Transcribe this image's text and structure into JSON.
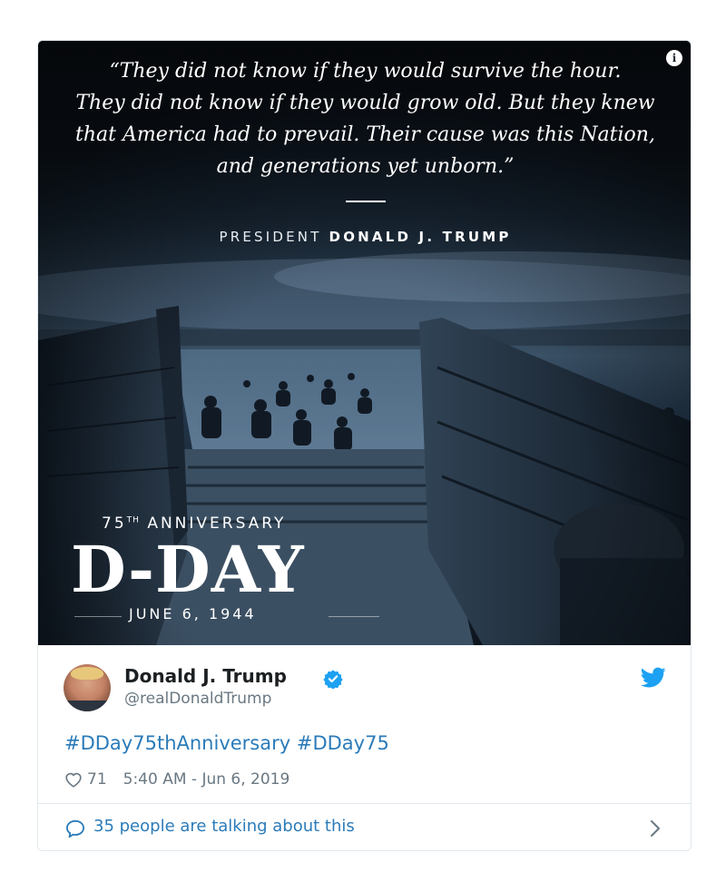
{
  "graphic": {
    "quote_lines": [
      "“They did not know if they would survive the hour.",
      "They did not know if they would grow old. But they knew",
      "that America had to prevail. Their cause was this Nation,",
      "and generations yet unborn.”"
    ],
    "attribution_prefix": "PRESIDENT",
    "attribution_name": "DONALD J. TRUMP",
    "anniversary_number": "75",
    "anniversary_suffix": "TH",
    "anniversary_word": "ANNIVERSARY",
    "headline": "D-DAY",
    "date": "JUNE 6, 1944"
  },
  "tweet": {
    "display_name": "Donald J. Trump",
    "handle": "@realDonaldTrump",
    "hashtags": [
      "#DDay75thAnniversary",
      "#DDay75"
    ],
    "likes": "71",
    "timestamp": "5:40 AM - Jun 6, 2019",
    "talking_label": "35 people are talking about this"
  },
  "icons": {
    "info": "info-icon",
    "verified": "verified-badge-icon",
    "brand": "twitter-bird-icon",
    "like": "heart-icon",
    "conversation": "speech-bubble-icon",
    "more": "chevron-right-icon"
  },
  "colors": {
    "link": "#2b7bb9",
    "muted": "#697882",
    "verified": "#1da1f2",
    "twitter_brand": "#1da1f2",
    "border": "#e1e8ed"
  }
}
